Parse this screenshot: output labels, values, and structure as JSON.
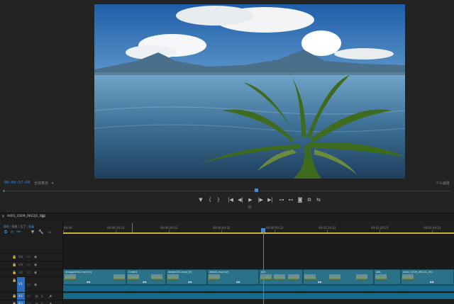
{
  "monitor": {
    "timecode": "00:00:57:04",
    "fit": "全体表示",
    "quality": "フル画質"
  },
  "transport": {
    "marker": "▼",
    "in": "{",
    "out": "}",
    "goto_in": "|◀",
    "step_back": "◀|",
    "play": "▶",
    "step_forward": "|▶",
    "goto_out": "▶|",
    "insert": "⊶",
    "overwrite": "⊷",
    "export_frame": "◙",
    "compare": "⧉",
    "loop": "⇆",
    "settings": "⊙"
  },
  "timeline": {
    "sequence_name": "A001_C009_0922J1_001",
    "timecode": "00:00:57:04",
    "ruler": [
      "00:00",
      "00:00:14:23",
      "00:00:29:23",
      "00:00:44:22",
      "00:00:59:22",
      "00:01:14:22",
      "00:01:29:21",
      "00:01:44:21"
    ],
    "tracks": [
      {
        "name": "V4"
      },
      {
        "name": "V3"
      },
      {
        "name": "V2"
      },
      {
        "name": "V1"
      },
      {
        "name": "A1"
      },
      {
        "name": "A2"
      }
    ],
    "clips": [
      {
        "label": "Amapala001.mp4 [V]"
      },
      {
        "label": "Chat01"
      },
      {
        "label": "Atitlan001.mp4 [V]"
      },
      {
        "label": "Xela01.mp4 [V]"
      },
      {
        "label": "A01"
      },
      {
        "label": "ABC"
      },
      {
        "label": "A001_C009_0922J1_001"
      }
    ]
  }
}
